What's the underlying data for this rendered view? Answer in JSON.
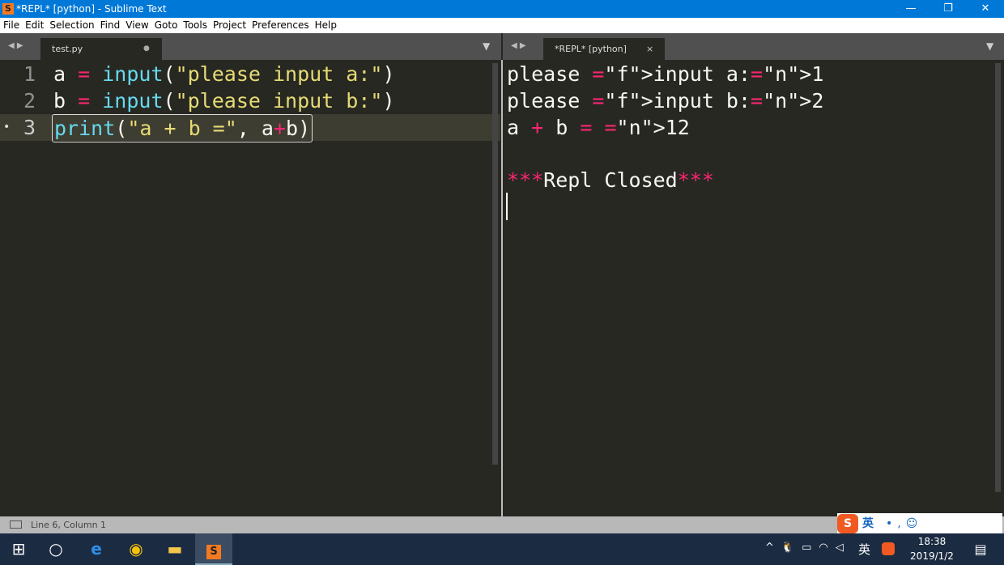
{
  "window": {
    "title": "*REPL* [python] - Sublime Text",
    "minimize": "—",
    "restore": "❐",
    "close": "✕"
  },
  "menu": [
    "File",
    "Edit",
    "Selection",
    "Find",
    "View",
    "Goto",
    "Tools",
    "Project",
    "Preferences",
    "Help"
  ],
  "left_pane": {
    "tab": "test.py",
    "dirty_dot": "●",
    "lines": [
      "1",
      "2",
      "3"
    ]
  },
  "right_pane": {
    "tab": "*REPL* [python]",
    "close": "×",
    "output": [
      "please input a:1",
      "please input b:2",
      "a + b = 12",
      "",
      "***Repl Closed***"
    ]
  },
  "status": {
    "text": "Line 6, Column 1"
  },
  "ime": {
    "logo": "S",
    "lang": "英"
  },
  "tray": {
    "time": "18:38",
    "date": "2019/1/2",
    "lang": "英"
  }
}
